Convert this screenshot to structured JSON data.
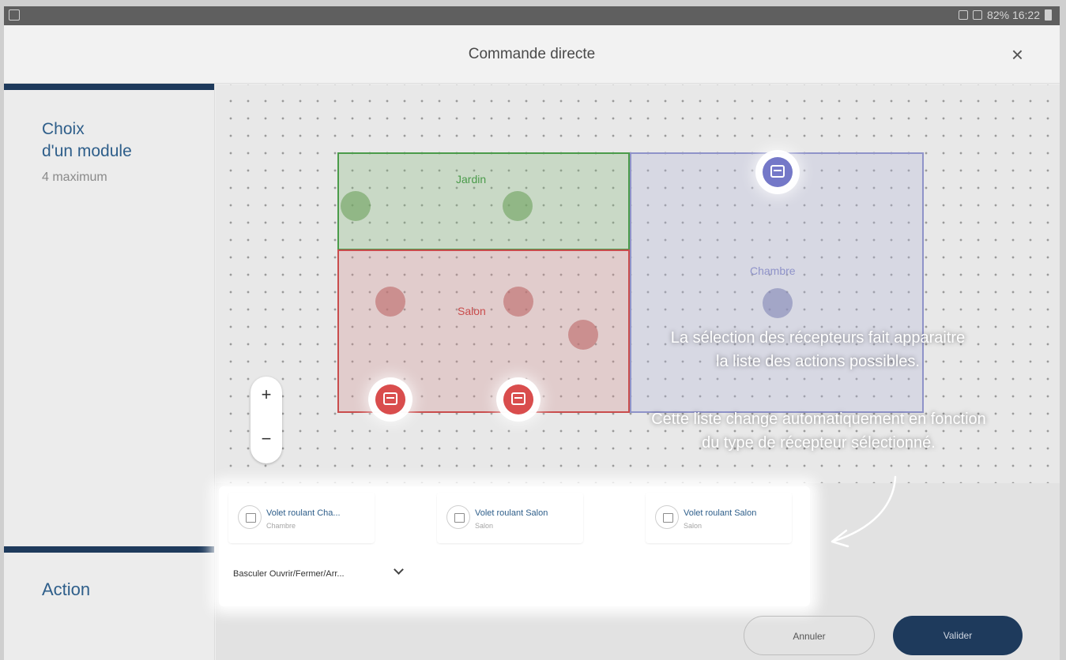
{
  "statusbar": {
    "right_text": "82% 16:22"
  },
  "header": {
    "title": "Commande directe",
    "close_label": "×"
  },
  "sidebar": {
    "choix_line1": "Choix",
    "choix_line2": "d'un module",
    "maximum": "4 maximum",
    "action_label": "Action"
  },
  "map": {
    "rooms": {
      "jardin": "Jardin",
      "salon": "Salon",
      "chambre": "Chambre"
    },
    "zoom": {
      "plus": "+",
      "minus": "−"
    }
  },
  "overlay": {
    "line1": "La sélection des récepteurs fait apparaitre",
    "line2": "la liste des actions possibles.",
    "line3": "Cette liste change automatiquement en fonction",
    "line4": "du type de récepteur sélectionné."
  },
  "selected_modules": [
    {
      "name": "Volet roulant Cha...",
      "room": "Chambre"
    },
    {
      "name": "Volet roulant Salon",
      "room": "Salon"
    },
    {
      "name": "Volet roulant Salon",
      "room": "Salon"
    }
  ],
  "action_select": {
    "value": "Basculer Ouvrir/Fermer/Arr..."
  },
  "buttons": {
    "cancel": "Annuler",
    "ok": "Valider"
  }
}
